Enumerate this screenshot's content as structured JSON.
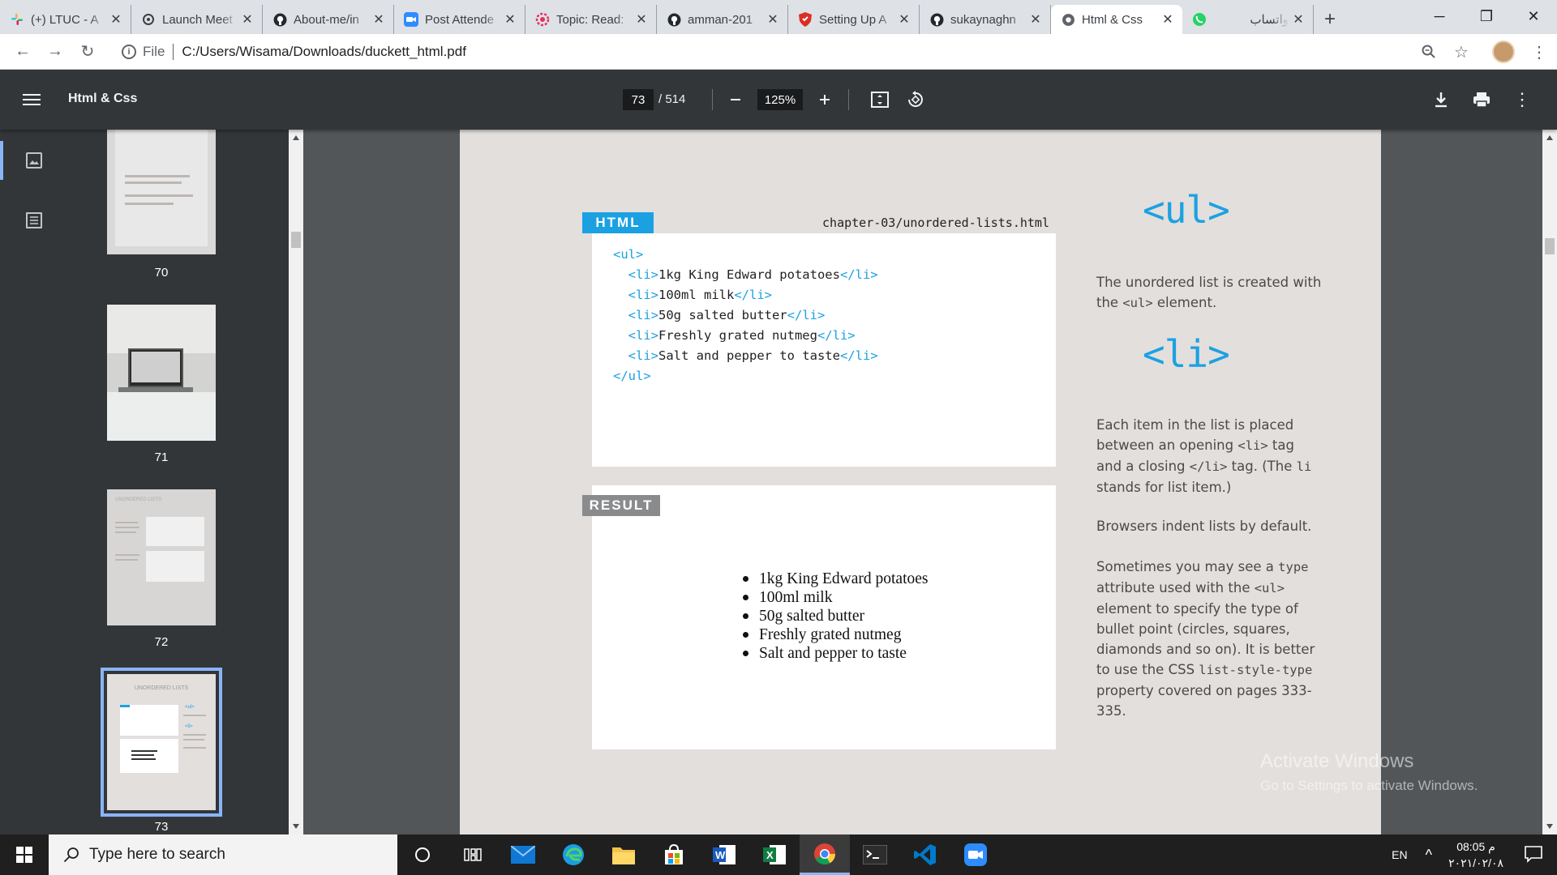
{
  "browser": {
    "tabs": [
      {
        "label": "(+) LTUC - A",
        "icon": "slack-icon",
        "active": false
      },
      {
        "label": "Launch Meet",
        "icon": "zoom-icon",
        "active": false
      },
      {
        "label": "About-me/in",
        "icon": "github-icon",
        "active": false
      },
      {
        "label": "Post Attende",
        "icon": "video-icon",
        "active": false
      },
      {
        "label": "Topic: Read:",
        "icon": "gear-icon",
        "active": false
      },
      {
        "label": "amman-201",
        "icon": "github-icon",
        "active": false
      },
      {
        "label": "Setting Up A",
        "icon": "shield-icon",
        "active": false
      },
      {
        "label": "sukaynaghn",
        "icon": "github-icon",
        "active": false
      },
      {
        "label": "Html & Css",
        "icon": "globe-icon",
        "active": true
      },
      {
        "label": "واتساب",
        "icon": "whatsapp-icon",
        "active": false
      }
    ],
    "address": {
      "scheme_label": "File",
      "url": "C:/Users/Wisama/Downloads/duckett_html.pdf"
    }
  },
  "pdf_viewer": {
    "title": "Html & Css",
    "current_page": "73",
    "page_total": "/ 514",
    "zoom": "125%",
    "thumbnails": [
      {
        "number": "70"
      },
      {
        "number": "71"
      },
      {
        "number": "72"
      },
      {
        "number": "73"
      }
    ],
    "thumb_heading": "UNORDERED LISTS"
  },
  "page": {
    "code_tag": "HTML",
    "code_file": "chapter-03/unordered-lists.html",
    "code_lines": [
      {
        "indent": "",
        "open": "<ul>",
        "text": "",
        "close": ""
      },
      {
        "indent": "  ",
        "open": "<li>",
        "text": "1kg King Edward potatoes",
        "close": "</li>"
      },
      {
        "indent": "  ",
        "open": "<li>",
        "text": "100ml milk",
        "close": "</li>"
      },
      {
        "indent": "  ",
        "open": "<li>",
        "text": "50g salted butter",
        "close": "</li>"
      },
      {
        "indent": "  ",
        "open": "<li>",
        "text": "Freshly grated nutmeg",
        "close": "</li>"
      },
      {
        "indent": "  ",
        "open": "<li>",
        "text": "Salt and pepper to taste",
        "close": "</li>"
      },
      {
        "indent": "",
        "open": "</ul>",
        "text": "",
        "close": ""
      }
    ],
    "result_tag": "RESULT",
    "result_items": [
      "1kg King Edward potatoes",
      "100ml milk",
      "50g salted butter",
      "Freshly grated nutmeg",
      "Salt and pepper to taste"
    ],
    "ul_heading": "<ul>",
    "ul_text_a": "The unordered list is created with the ",
    "ul_text_code": "<ul>",
    "ul_text_b": " element.",
    "li_heading": "<li>",
    "li_text_a": "Each item in the list is placed between an opening ",
    "li_text_code1": "<li>",
    "li_text_b": " tag and a closing ",
    "li_text_code2": "</li>",
    "li_text_c": " tag. (The ",
    "li_text_code3": "li",
    "li_text_d": " stands for list item.)",
    "indent_note": "Browsers indent lists by default.",
    "type_a": "Sometimes you may see a ",
    "type_code1": "type",
    "type_b": " attribute used with the ",
    "type_code2": "<ul>",
    "type_c": " element to specify the type of bullet point (circles, squares, diamonds and so on). It is better to use the CSS ",
    "type_code3": "list-style-type",
    "type_d": " property covered on pages 333-335."
  },
  "watermark": {
    "line1": "Activate Windows",
    "line2": "Go to Settings to activate Windows."
  },
  "taskbar": {
    "search_placeholder": "Type here to search",
    "language": "EN",
    "time": "08:05 م",
    "date": "٢٠٢١/٠٢/٠٨"
  },
  "colors": {
    "accent": "#1ba1e2",
    "result_gray": "#8a8b8d",
    "viewer_bar": "#323639"
  }
}
